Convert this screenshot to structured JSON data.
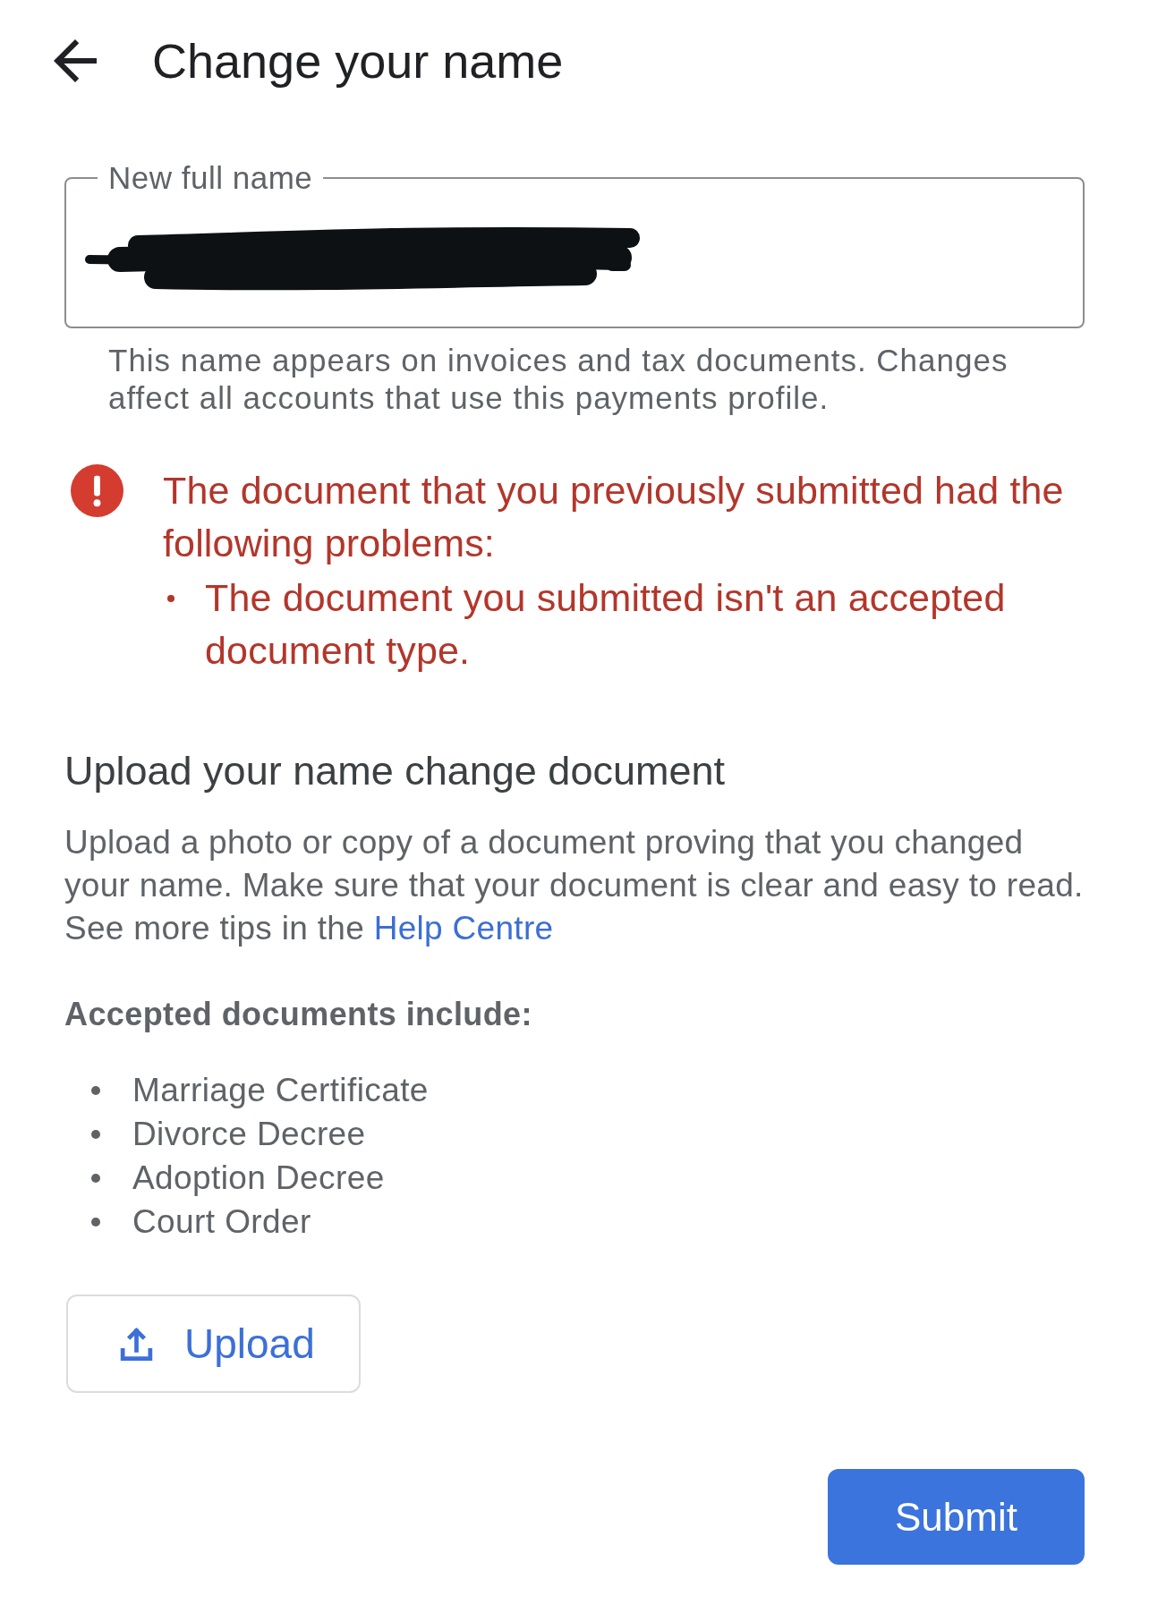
{
  "header": {
    "title": "Change your name"
  },
  "name_field": {
    "label": "New full name",
    "redacted": true,
    "helper_text": "This name appears on invoices and tax documents. Changes affect all accounts that use this payments profile."
  },
  "error": {
    "message": "The document that you previously submitted had the following problems:",
    "problems": [
      "The document you submitted isn't an accepted document type."
    ]
  },
  "upload_section": {
    "heading": "Upload your name change document",
    "description": "Upload a photo or copy of a document proving that you changed your name. Make sure that your document is clear and easy to read. See more tips in the",
    "link": "Help Centre",
    "accepted_heading": "Accepted documents include:",
    "accepted_documents": [
      "Marriage Certificate",
      "Divorce Decree",
      "Adoption Decree",
      "Court Order"
    ],
    "upload_button": "Upload"
  },
  "submit_button": "Submit"
}
